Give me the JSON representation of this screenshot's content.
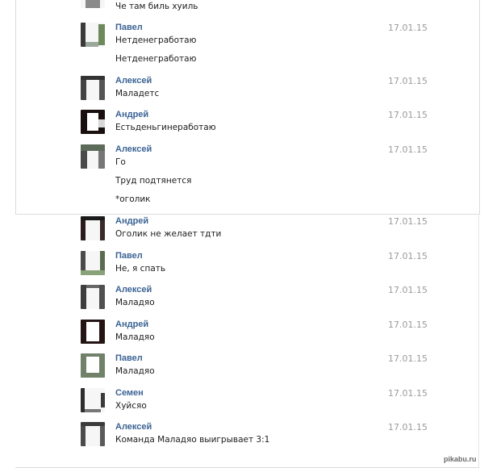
{
  "top_line": "Че там биль хуиль",
  "messages": [
    {
      "author": "Павел",
      "date": "17.01.15",
      "lines": [
        "Нетденегработаю",
        "Нетденегработаю"
      ]
    },
    {
      "author": "Алексей",
      "date": "17.01.15",
      "lines": [
        "Маладетс"
      ]
    },
    {
      "author": "Андрей",
      "date": "17.01.15",
      "lines": [
        "Естьденьгинеработаю"
      ]
    },
    {
      "author": "Алексей",
      "date": "17.01.15",
      "lines": [
        "Го",
        "Труд подтянется",
        "*оголик"
      ]
    },
    {
      "author": "Андрей",
      "date": "17.01.15",
      "lines": [
        "Оголик не желает тдти"
      ]
    },
    {
      "author": "Павел",
      "date": "17.01.15",
      "lines": [
        "Не, я спать"
      ]
    },
    {
      "author": "Алексей",
      "date": "17.01.15",
      "lines": [
        "Маладяо"
      ]
    },
    {
      "author": "Андрей",
      "date": "17.01.15",
      "lines": [
        "Маладяо"
      ]
    },
    {
      "author": "Павел",
      "date": "17.01.15",
      "lines": [
        "Маладяо"
      ]
    },
    {
      "author": "Семен",
      "date": "17.01.15",
      "lines": [
        "Хуйсяо"
      ]
    },
    {
      "author": "Алексей",
      "date": "17.01.15",
      "lines": [
        "Команда Маладяо выигрывает 3:1"
      ]
    }
  ],
  "watermark": "pikabu.ru",
  "colors": {
    "author": "#3b6394",
    "date": "#9b9b9b",
    "text": "#1c1c1c"
  }
}
